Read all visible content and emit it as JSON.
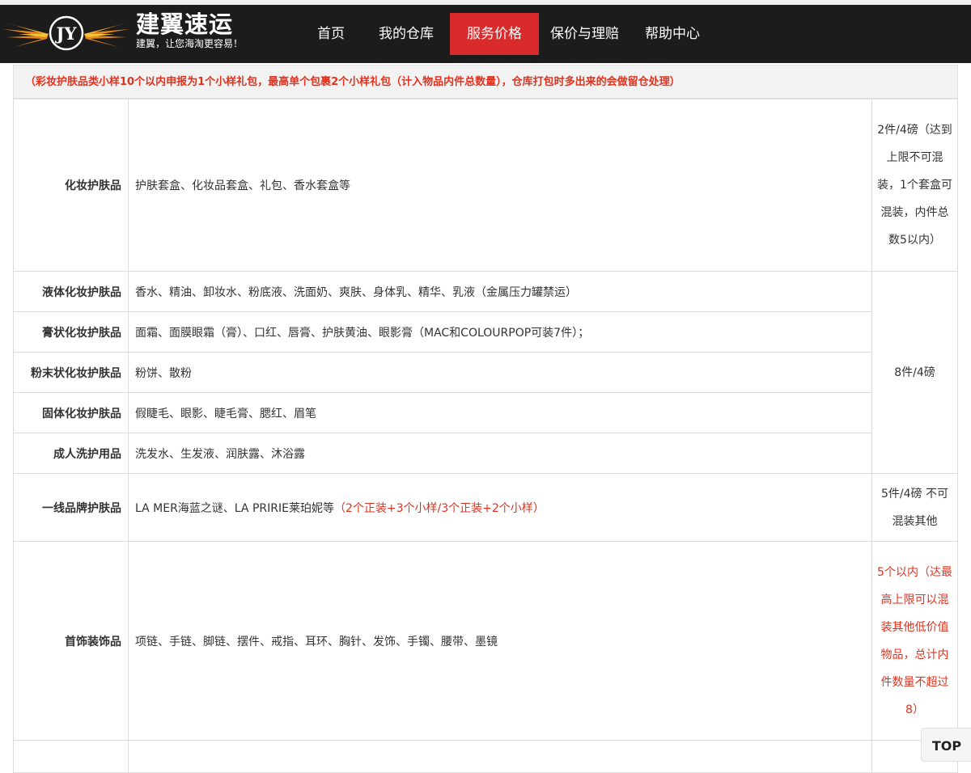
{
  "header": {
    "logo_text": "JY",
    "brand_name": "建翼速运",
    "slogan": "建翼，让您海淘更容易！",
    "nav": [
      {
        "label": "首页",
        "active": false
      },
      {
        "label": "我的仓库",
        "active": false
      },
      {
        "label": "服务价格",
        "active": true
      },
      {
        "label": "保价与理赔",
        "active": false
      },
      {
        "label": "帮助中心",
        "active": false
      }
    ]
  },
  "notice": "（彩妆护肤品类小样10个以内申报为1个小样礼包，最高单个包裹2个小样礼包（计入物品内件总数量），仓库打包时多出来的会做留仓处理）",
  "table": {
    "rows": [
      {
        "category": "化妆护肤品",
        "items": "护肤套盒、化妆品套盒、礼包、香水套盒等",
        "items_note": "",
        "limit": "2件/4磅（达到上限不可混装，1个套盒可混装，内件总数5以内）"
      },
      {
        "category": "液体化妆护肤品",
        "items": "香水、精油、卸妆水、粉底液、洗面奶、爽肤、身体乳、精华、乳液（金属压力罐禁运）",
        "items_note": ""
      },
      {
        "category": "膏状化妆护肤品",
        "items": "面霜、面膜眼霜（膏）、口红、唇膏、护肤黄油、眼影膏（MAC和COLOURPOP可装7件）；",
        "items_note": ""
      },
      {
        "category": "粉末状化妆护肤品",
        "items": "粉饼、散粉",
        "items_note": ""
      },
      {
        "category": "固体化妆护肤品",
        "items": "假睫毛、眼影、睫毛膏、腮红、眉笔",
        "items_note": ""
      },
      {
        "category": "成人洗护用品",
        "items": "洗发水、生发液、润肤露、沐浴露",
        "items_note": ""
      },
      {
        "category": "一线品牌护肤品",
        "items": "LA MER海蓝之谜、LA PRIRIE莱珀妮等",
        "items_note": "（2个正装+3个小样/3个正装+2个小样）",
        "limit": "5件/4磅 不可混装其他"
      },
      {
        "category": "首饰装饰品",
        "items": "项链、手链、脚链、摆件、戒指、耳环、胸针、发饰、手镯、腰带、墨镜",
        "items_note": "",
        "limit": "5个以内（达最高上限可以混装其他低价值物品，总计内件数量不超过8）"
      }
    ],
    "group_limit": "8件/4磅"
  },
  "top_button": "TOP",
  "colors": {
    "accent": "#d92b2b",
    "header_bg": "#1c1c1c",
    "notice_red": "#e0321e"
  }
}
